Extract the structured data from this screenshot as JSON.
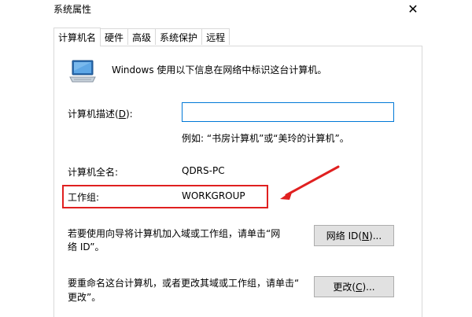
{
  "window": {
    "title": "系统属性",
    "close_glyph": "✕"
  },
  "tabs": [
    {
      "label": "计算机名",
      "active": true
    },
    {
      "label": "硬件",
      "active": false
    },
    {
      "label": "高级",
      "active": false
    },
    {
      "label": "系统保护",
      "active": false
    },
    {
      "label": "远程",
      "active": false
    }
  ],
  "panel": {
    "intro_text": "Windows 使用以下信息在网络中标识这台计算机。",
    "description": {
      "label_pre": "计算机描述(",
      "label_key": "D",
      "label_post": "):",
      "value": "",
      "example": "例如: “书房计算机”或“美玲的计算机”。"
    },
    "full_name": {
      "label": "计算机全名:",
      "value": "QDRS-PC"
    },
    "workgroup": {
      "label": "工作组:",
      "value": "WORKGROUP"
    },
    "network_id": {
      "text_line1": "若要使用向导将计算机加入域或工作组，请单击“网",
      "text_line2": "络 ID”。",
      "button_pre": "网络 ID(",
      "button_key": "N",
      "button_post": ")..."
    },
    "change": {
      "text_line1": "要重命名这台计算机，或者更改其域或工作组，请单击“",
      "text_line2": "更改”。",
      "button_pre": "更改(",
      "button_key": "C",
      "button_post": ")..."
    }
  },
  "annotation": {
    "color": "#e02020"
  },
  "icons": [
    "computer-icon",
    "close-icon",
    "red-arrow-annotation"
  ]
}
